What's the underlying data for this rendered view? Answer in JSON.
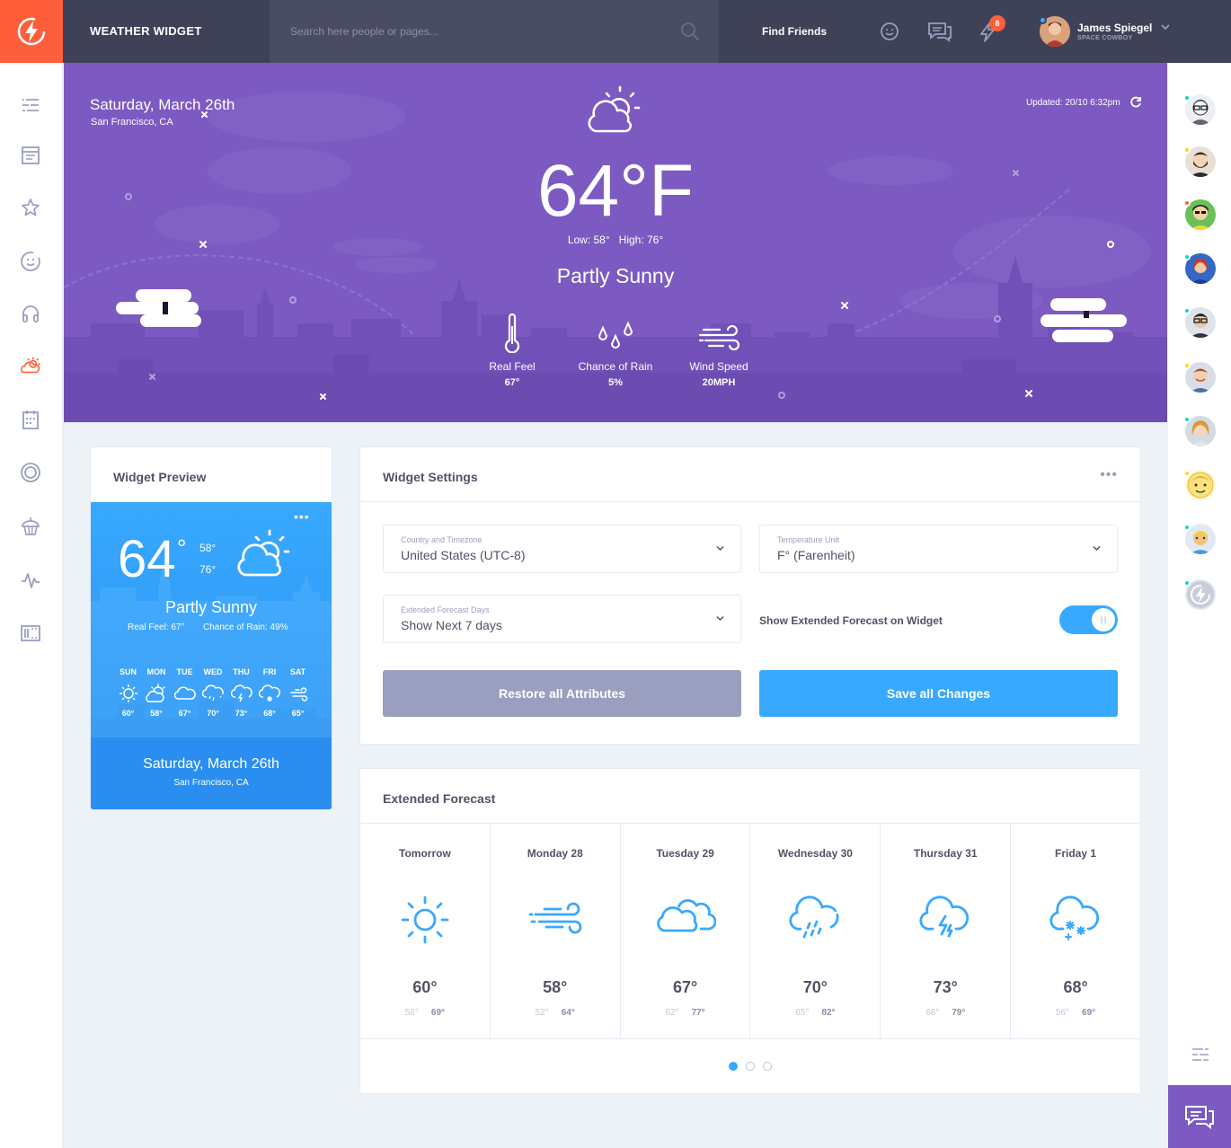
{
  "header": {
    "app_title": "WEATHER WIDGET",
    "search_placeholder": "Search here people or pages...",
    "find_friends": "Find Friends",
    "notification_count": "8",
    "user": {
      "name": "James Spiegel",
      "subtitle": "SPACE COWBOY"
    }
  },
  "left_nav": {
    "items": [
      "menu-lines-icon",
      "newsfeed-icon",
      "star-icon",
      "happy-face-icon",
      "headphones-icon",
      "weather-icon",
      "calendar-icon",
      "badge-icon",
      "cupcake-icon",
      "stats-icon",
      "manage-widgets-icon"
    ],
    "active": "weather-icon"
  },
  "right_sidebar": {
    "friend_count": 10,
    "status_colors": [
      "#08ddc1",
      "#ffd71b",
      "#ff5e3a",
      "#08ddc1",
      "#08ddc1",
      "#ffd71b",
      "#08ddc1",
      "#ffd71b",
      "#08ddc1",
      "#08ddc1"
    ]
  },
  "hero": {
    "date": "Saturday, March 26th",
    "location": "San Francisco, CA",
    "updated": "Updated: 20/10 6:32pm",
    "temperature": "64°F",
    "low_high": "Low: 58°   High: 76°",
    "condition": "Partly Sunny",
    "stats": [
      {
        "label": "Real Feel",
        "value": "67°",
        "icon": "thermometer-icon"
      },
      {
        "label": "Chance of Rain",
        "value": "5%",
        "icon": "raindrops-icon"
      },
      {
        "label": "Wind Speed",
        "value": "20MPH",
        "icon": "wind-icon"
      }
    ]
  },
  "widget_preview": {
    "title": "Widget Preview",
    "temperature": "64",
    "degree": "°",
    "high": "58°",
    "low": "76°",
    "condition": "Partly Sunny",
    "real_feel": "Real Feel: 67°",
    "chance_rain": "Chance of Rain: 49%",
    "days": [
      {
        "name": "SUN",
        "temp": "60°",
        "icon": "sun-icon"
      },
      {
        "name": "MON",
        "temp": "58°",
        "icon": "partly-sunny-icon"
      },
      {
        "name": "TUE",
        "temp": "67°",
        "icon": "cloud-icon"
      },
      {
        "name": "WED",
        "temp": "70°",
        "icon": "rain-cloud-icon"
      },
      {
        "name": "THU",
        "temp": "73°",
        "icon": "storm-cloud-icon"
      },
      {
        "name": "FRI",
        "temp": "68°",
        "icon": "snow-cloud-icon"
      },
      {
        "name": "SAT",
        "temp": "65°",
        "icon": "wind-icon"
      }
    ],
    "date": "Saturday, March 26th",
    "location": "San Francisco, CA"
  },
  "settings": {
    "title": "Widget Settings",
    "country_label": "Country and Timezone",
    "country_value": "United States (UTC-8)",
    "unit_label": "Temperature Unit",
    "unit_value": "F° (Farenheit)",
    "days_label": "Extended Forecast Days",
    "days_value": "Show Next 7 days",
    "toggle_label": "Show Extended Forecast on Widget",
    "toggle_on": true,
    "restore_button": "Restore all Attributes",
    "save_button": "Save all Changes"
  },
  "extended_forecast": {
    "title": "Extended Forecast",
    "days": [
      {
        "day": "Tomorrow",
        "temp": "60°",
        "low": "56°",
        "high": "69°",
        "icon": "sun-icon"
      },
      {
        "day": "Monday 28",
        "temp": "58°",
        "low": "52°",
        "high": "64°",
        "icon": "wind-icon"
      },
      {
        "day": "Tuesday 29",
        "temp": "67°",
        "low": "62°",
        "high": "77°",
        "icon": "cloud-icon"
      },
      {
        "day": "Wednesday 30",
        "temp": "70°",
        "low": "65°",
        "high": "82°",
        "icon": "rain-cloud-icon"
      },
      {
        "day": "Thursday 31",
        "temp": "73°",
        "low": "68°",
        "high": "79°",
        "icon": "storm-cloud-icon"
      },
      {
        "day": "Friday 1",
        "temp": "68°",
        "low": "56°",
        "high": "69°",
        "icon": "snow-cloud-icon"
      }
    ],
    "page_count": 3,
    "active_page": 1
  },
  "colors": {
    "brand_orange": "#ff5e3a",
    "topbar": "#3f4257",
    "hero_purple": "#7c5ac2",
    "accent_blue": "#38a9ff",
    "muted_button": "#9a9fbf"
  }
}
